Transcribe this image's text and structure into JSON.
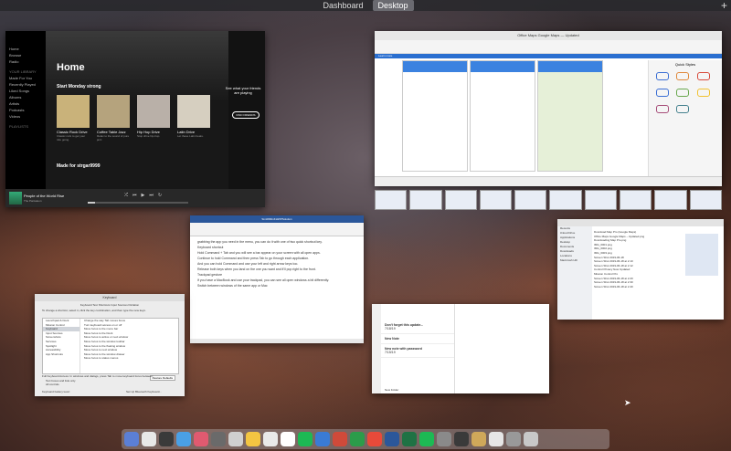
{
  "spaces": {
    "items": [
      {
        "label": "Dashboard"
      },
      {
        "label": "Desktop"
      }
    ]
  },
  "spotify": {
    "sidebar": [
      "Home",
      "Browse",
      "Radio"
    ],
    "library_header": "YOUR LIBRARY",
    "library": [
      "Made For You",
      "Recently Played",
      "Liked Songs",
      "Albums",
      "Artists",
      "Podcasts",
      "Videos"
    ],
    "playlists_header": "PLAYLISTS",
    "title": "Home",
    "section1": "Start Monday strong",
    "cards": [
      {
        "title": "Classic Rock Drive",
        "sub": "Classic rock to get your ride going.",
        "color": "#c9b27a"
      },
      {
        "title": "Coffee Table Jazz",
        "sub": "Relax to the sound of pure jazz.",
        "color": "#b5a37d"
      },
      {
        "title": "Hip Hop Drive",
        "sub": "Stop drive hip-hop.",
        "color": "#b9b0a8"
      },
      {
        "title": "Latin Drive",
        "sub": "Let these Latin beats.",
        "color": "#d6cfc0"
      }
    ],
    "friends": "See what your friends are playing",
    "find_friends": "FIND FRIENDS",
    "section2": "Made for strgar9999",
    "track": "People of the World Rise",
    "artist": "The Pantaleon"
  },
  "office_maps": {
    "title": "Office Maps Google Maps — Updated",
    "banner": "Learn more",
    "quick_styles": "Quick Styles",
    "shape_colors": [
      "#3b6fd4",
      "#e0893b",
      "#d84a3b",
      "#3b6fd4",
      "#6aa84f",
      "#f1c232",
      "#a64d79",
      "#45818e"
    ]
  },
  "word": {
    "title": "Sim06MinKHWPSolution",
    "heading": "Keyboard shortcut",
    "lines": [
      "grabbing the app you need in the menu, you can do it with one of two quick shortcut key.",
      "Keyboard shortcut",
      "Hold Command + Tab and you will see a bar appear on your screen with all open apps.",
      "Continue to hold Command and then press Tab to go through each application.",
      "And you can hold Command and use your left and right arrow keys too.",
      "Release both keys when you land on the one you want and it'll pop right to the front.",
      "Trackpad gesture",
      "If you have a MacBook and use your trackpad, you can see all open windows a bit differently.",
      "Switch between windows of the same app or Mac"
    ]
  },
  "keyboard": {
    "title": "Keyboard",
    "tabs": "Keyboard   Text   Shortcuts   Input Sources   Dictation",
    "intro": "To change a shortcut, select it, click the key combination, and then type the new keys.",
    "categories": [
      "Launchpad & Dock",
      "Mission Control",
      "Keyboard",
      "Input Sources",
      "Screenshots",
      "Services",
      "Spotlight",
      "Accessibility",
      "App Shortcuts"
    ],
    "shortcuts": [
      "Change the way Tab moves focus",
      "Turn keyboard access on or off",
      "Move focus to the menu bar",
      "Move focus to the Dock",
      "Move focus to active or next window",
      "Move focus to the window toolbar",
      "Move focus to the floating window",
      "Move focus to next window",
      "Move focus to the window drawer",
      "Move focus to status menus"
    ],
    "restore": "Restore Defaults",
    "full_access": "Full Keyboard Access: In windows and dialogs, press Tab to move keyboard focus between:",
    "opt1": "Text boxes and lists only",
    "opt2": "All controls",
    "battery": "Keyboard battery level:",
    "bluetooth": "Set Up Bluetooth Keyboard..."
  },
  "mail": {
    "items": [
      {
        "title": "Don't forget this update...",
        "date": "7/18/19"
      },
      {
        "title": "New Note",
        "date": ""
      },
      {
        "title": "New note with password",
        "date": "7/15/19"
      }
    ],
    "footer": "New Folder"
  },
  "finder": {
    "sidebar": [
      "Recents",
      "iCloud Drive",
      "Applications",
      "Desktop",
      "Documents",
      "Downloads",
      "Locations",
      "Macintosh HD"
    ],
    "files": [
      "Download Map Pro (Google Maps)",
      "Office Maps Google Maps – Updated.png",
      "Downloading Map Pro.png",
      "IMG_0001.png",
      "IMG_0002.png",
      "IMG_0003.png",
      "Screen Shot 2019-06-18",
      "Screen Shot 2019-06-18 at 2.10",
      "Screen Shot 2019-06-18 at 2.12",
      "Control Privacy Now Updated",
      "Mission Control Pro",
      "Screen Shot 2019-06-18 at 2.20",
      "Screen Shot 2019-06-18 at 2.30",
      "Screen Shot 2019-06-18 at 2.40"
    ]
  },
  "dock": {
    "colors": [
      "#5b7fd6",
      "#e8e8e8",
      "#3a3a3a",
      "#4aa0e6",
      "#e05a70",
      "#6a6a6a",
      "#d0d0d0",
      "#f4c542",
      "#e9e9e9",
      "#ffffff",
      "#1db954",
      "#3a7bd5",
      "#d04a3a",
      "#2b9c4a",
      "#e84a3a",
      "#2b579a",
      "#1f7244",
      "#1db954",
      "#8a8a8a",
      "#3a3a3a",
      "#cfa85a",
      "#e6e6e6",
      "#999999",
      "#c8c8c8"
    ]
  }
}
